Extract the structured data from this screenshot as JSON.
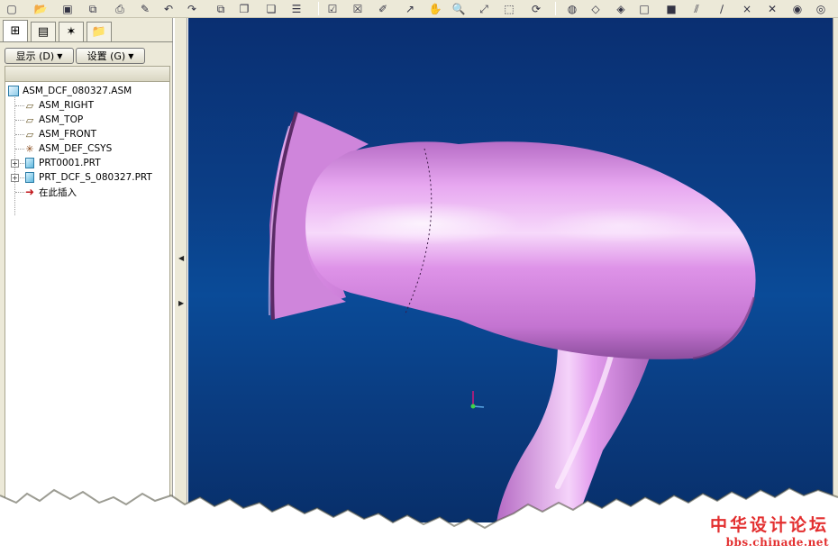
{
  "toolbar": {
    "icons": [
      {
        "name": "new-icon",
        "glyph": "▢"
      },
      {
        "name": "open-icon",
        "glyph": "📂"
      },
      {
        "name": "save-icon",
        "glyph": "▣"
      },
      {
        "name": "save-copy-icon",
        "glyph": "⧉"
      },
      {
        "name": "print-icon",
        "glyph": "⎙"
      },
      {
        "name": "paint-icon",
        "glyph": "✎"
      },
      {
        "name": "undo-icon",
        "glyph": "↶"
      },
      {
        "name": "redo-icon",
        "glyph": "↷"
      },
      {
        "name": "copy-icon",
        "glyph": "⧉"
      },
      {
        "name": "paste-icon",
        "glyph": "❐"
      },
      {
        "name": "paste-special-icon",
        "glyph": "❏"
      },
      {
        "name": "regenerate-icon",
        "glyph": "☰"
      },
      {
        "name": "check-icon",
        "glyph": "☑"
      },
      {
        "name": "cancel-icon",
        "glyph": "☒"
      },
      {
        "name": "edit-icon",
        "glyph": "✐"
      },
      {
        "name": "sketch-icon",
        "glyph": "↗"
      },
      {
        "name": "pan-hand-icon",
        "glyph": "✋"
      },
      {
        "name": "zoom-in-icon",
        "glyph": "🔍"
      },
      {
        "name": "zoom-out-icon",
        "glyph": "⤢"
      },
      {
        "name": "refit-icon",
        "glyph": "⬚"
      },
      {
        "name": "repaint-icon",
        "glyph": "⟳"
      },
      {
        "name": "appearance-icon",
        "glyph": "◍"
      },
      {
        "name": "wireframe-icon",
        "glyph": "◇"
      },
      {
        "name": "hidden-line-icon",
        "glyph": "◈"
      },
      {
        "name": "no-hidden-icon",
        "glyph": "□"
      },
      {
        "name": "shading-icon",
        "glyph": "■"
      },
      {
        "name": "datum-planes-icon",
        "glyph": "⫽"
      },
      {
        "name": "datum-axes-icon",
        "glyph": "∕"
      },
      {
        "name": "datum-points-icon",
        "glyph": "×"
      },
      {
        "name": "csys-icon",
        "glyph": "✕"
      },
      {
        "name": "view-manager-icon",
        "glyph": "◉"
      },
      {
        "name": "saved-views-icon",
        "glyph": "◎"
      }
    ]
  },
  "panel": {
    "tabs": [
      {
        "name": "tab-model-tree",
        "glyph": "⊞"
      },
      {
        "name": "tab-layers",
        "glyph": "▤"
      },
      {
        "name": "tab-favorites",
        "glyph": "✶"
      },
      {
        "name": "tab-folder",
        "glyph": "📁"
      }
    ],
    "show_button": "显示 (D)",
    "settings_button": "设置 (G)"
  },
  "tree": {
    "root": "ASM_DCF_080327.ASM",
    "items": [
      {
        "label": "ASM_RIGHT",
        "type": "plane"
      },
      {
        "label": "ASM_TOP",
        "type": "plane"
      },
      {
        "label": "ASM_FRONT",
        "type": "plane"
      },
      {
        "label": "ASM_DEF_CSYS",
        "type": "csys"
      },
      {
        "label": "PRT0001.PRT",
        "type": "part",
        "expandable": true
      },
      {
        "label": "PRT_DCF_S_080327.PRT",
        "type": "part",
        "expandable": true
      },
      {
        "label": "在此插入",
        "type": "insert"
      }
    ]
  },
  "colors": {
    "viewport_top": "#0a2f72",
    "viewport_mid": "#0a4b98",
    "model_body": "#d98be6",
    "model_shadow": "#8f4fa0",
    "watermark": "#e32f2f"
  },
  "watermark": {
    "cn": "中华设计论坛",
    "url": "bbs.chinade.net"
  }
}
